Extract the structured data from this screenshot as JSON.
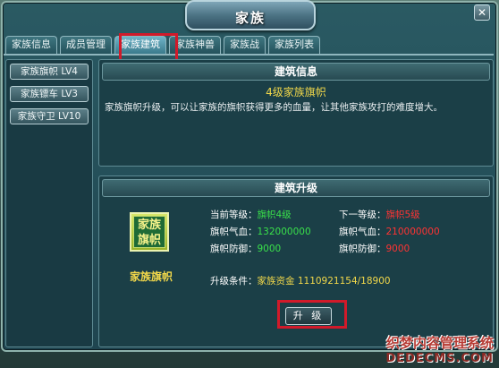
{
  "window": {
    "title": "家族"
  },
  "tabs": [
    {
      "label": "家族信息",
      "active": false
    },
    {
      "label": "成员管理",
      "active": false
    },
    {
      "label": "家族建筑",
      "active": true
    },
    {
      "label": "家族神兽",
      "active": false
    },
    {
      "label": "家族战",
      "active": false
    },
    {
      "label": "家族列表",
      "active": false
    }
  ],
  "sidebar": {
    "items": [
      {
        "label": "家族旗帜 LV4"
      },
      {
        "label": "家族镖车 LV3"
      },
      {
        "label": "家族守卫 LV10"
      }
    ]
  },
  "info": {
    "header": "建筑信息",
    "subtitle": "4级家族旗帜",
    "description": "家族旗帜升级，可以让家族的旗帜获得更多的血量，让其他家族攻打的难度增大。"
  },
  "upgrade": {
    "header": "建筑升级",
    "badge_text": "家族旗帜",
    "building_name": "家族旗帜",
    "current_level_label": "当前等级：",
    "current_level_value": "旗帜4级",
    "next_level_label": "下一等级：",
    "next_level_value": "旗帜5级",
    "current_hp_label": "旗帜气血：",
    "current_hp_value": "132000000",
    "next_hp_label": "旗帜气血：",
    "next_hp_value": "210000000",
    "current_def_label": "旗帜防御：",
    "current_def_value": "9000",
    "next_def_label": "旗帜防御：",
    "next_def_value": "9000",
    "condition_label": "升级条件：",
    "condition_value": "家族资金  1110921154/18900",
    "button_label": "升 级"
  },
  "watermark": {
    "line1": "织梦内容管理系统",
    "line2": "DEDECMS.COM"
  },
  "colors": {
    "highlight": "#d11a2a",
    "current_value": "#39e04a",
    "next_value": "#ff3333",
    "accent": "#f2d84a"
  }
}
